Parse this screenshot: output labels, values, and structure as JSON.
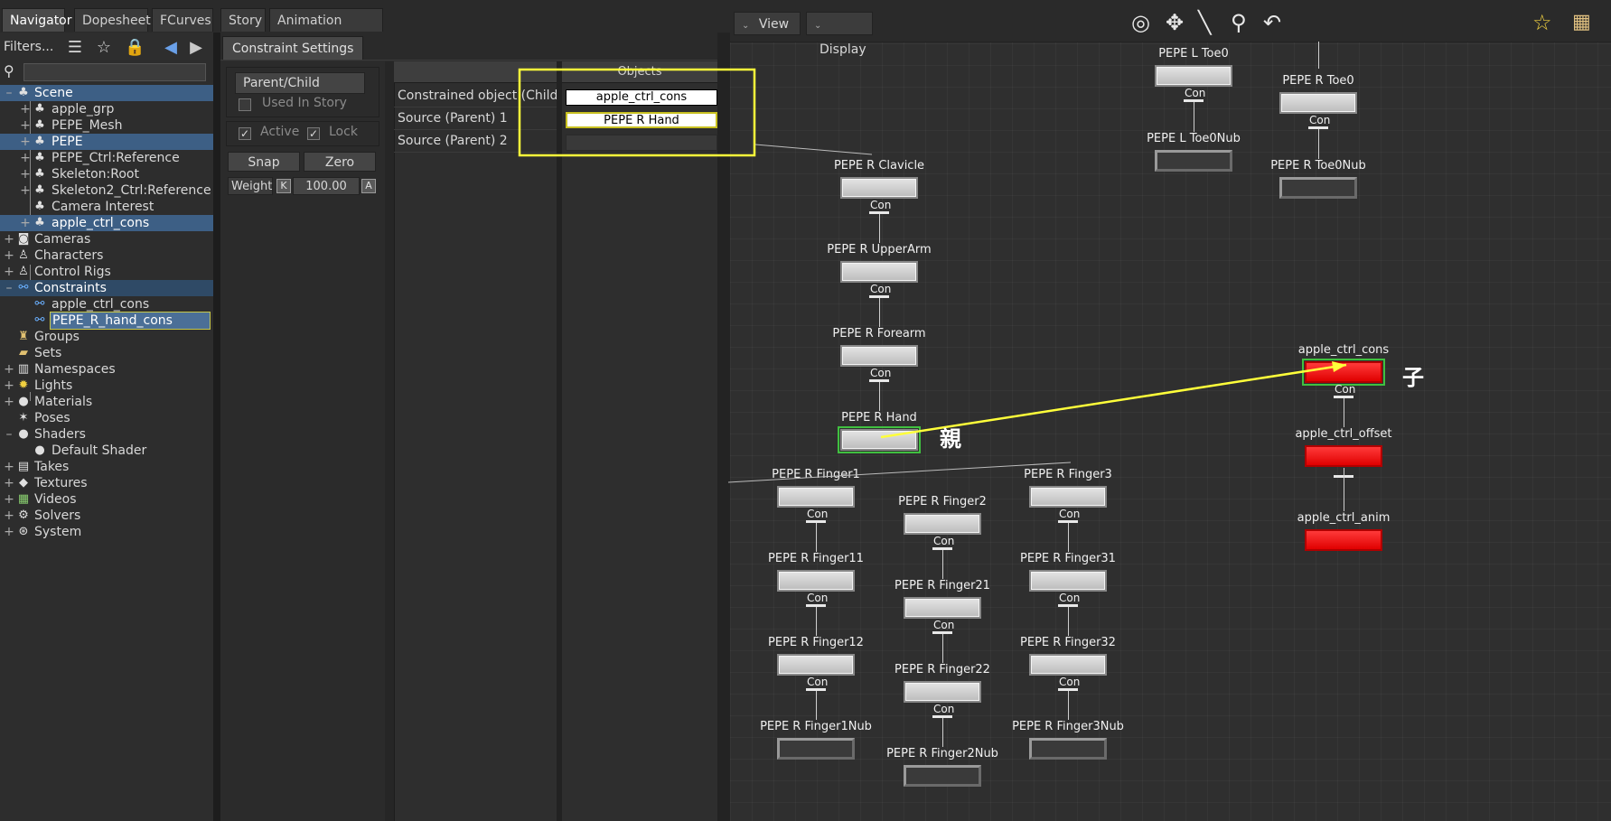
{
  "tabs": [
    "Navigator",
    "Dopesheet",
    "FCurves",
    "Story",
    "Animation Trigger"
  ],
  "navigator": {
    "filters_label": "Filters...",
    "search_value": "",
    "tree": [
      {
        "label": "Scene",
        "expander": "–",
        "icon": "scene-icon"
      },
      {
        "label": "apple_grp",
        "expander": "+",
        "icon": "model-icon"
      },
      {
        "label": "PEPE_Mesh",
        "expander": "+",
        "icon": "model-icon"
      },
      {
        "label": "PEPE",
        "expander": "+",
        "icon": "model-icon"
      },
      {
        "label": "PEPE_Ctrl:Reference",
        "expander": "+",
        "icon": "model-icon"
      },
      {
        "label": "Skeleton:Root",
        "expander": "+",
        "icon": "model-icon"
      },
      {
        "label": "Skeleton2_Ctrl:Reference",
        "expander": "+",
        "icon": "model-icon"
      },
      {
        "label": "Camera Interest",
        "expander": "",
        "icon": "model-icon"
      },
      {
        "label": "apple_ctrl_cons",
        "expander": "+",
        "icon": "model-icon"
      },
      {
        "label": "Cameras",
        "expander": "+",
        "icon": "camera-icon"
      },
      {
        "label": "Characters",
        "expander": "+",
        "icon": "character-icon"
      },
      {
        "label": "Control Rigs",
        "expander": "+",
        "icon": "control-rig-icon"
      },
      {
        "label": "Constraints",
        "expander": "–",
        "icon": "constraint-icon"
      },
      {
        "label": "apple_ctrl_cons",
        "expander": "",
        "icon": "constraint-icon"
      },
      {
        "label": "PEPE_R_hand_cons",
        "expander": "",
        "icon": "constraint-icon"
      },
      {
        "label": "Groups",
        "expander": "",
        "icon": "group-icon"
      },
      {
        "label": "Sets",
        "expander": "",
        "icon": "set-icon"
      },
      {
        "label": "Namespaces",
        "expander": "+",
        "icon": "namespace-icon"
      },
      {
        "label": "Lights",
        "expander": "+",
        "icon": "light-icon"
      },
      {
        "label": "Materials",
        "expander": "+",
        "icon": "material-icon"
      },
      {
        "label": "Poses",
        "expander": "",
        "icon": "pose-icon"
      },
      {
        "label": "Shaders",
        "expander": "–",
        "icon": "shader-icon"
      },
      {
        "label": "Default Shader",
        "expander": "",
        "icon": "shader-icon"
      },
      {
        "label": "Takes",
        "expander": "+",
        "icon": "take-icon"
      },
      {
        "label": "Textures",
        "expander": "+",
        "icon": "texture-icon"
      },
      {
        "label": "Videos",
        "expander": "+",
        "icon": "video-icon"
      },
      {
        "label": "Solvers",
        "expander": "+",
        "icon": "solver-icon"
      },
      {
        "label": "System",
        "expander": "+",
        "icon": "system-icon"
      }
    ]
  },
  "constraint_settings": {
    "tab": "Constraint Settings",
    "type": "Parent/Child",
    "used_in_story": "Used In Story",
    "active": "Active",
    "lock": "Lock",
    "snap": "Snap",
    "zero": "Zero",
    "weight_label": "Weight",
    "weight_key": "K",
    "weight_value": "100.00",
    "weight_anim": "A",
    "slots": [
      "Constrained object (Child)",
      "Source (Parent) 1",
      "Source (Parent) 2"
    ],
    "objects_header": "Objects",
    "objects": [
      "apple_ctrl_cons",
      "PEPE R Hand",
      ""
    ]
  },
  "schematic": {
    "view_label": "View",
    "display_label": "Display",
    "con_label": "Con",
    "nodes": [
      "PEPE L Toe0",
      "PEPE L Toe0Nub",
      "PEPE R Toe0",
      "PEPE R Toe0Nub",
      "PEPE R Clavicle",
      "PEPE R UpperArm",
      "PEPE R Forearm",
      "PEPE R Hand",
      "PEPE R Finger1",
      "PEPE R Finger11",
      "PEPE R Finger12",
      "PEPE R Finger1Nub",
      "PEPE R Finger2",
      "PEPE R Finger21",
      "PEPE R Finger22",
      "PEPE R Finger2Nub",
      "PEPE R Finger3",
      "PEPE R Finger31",
      "PEPE R Finger32",
      "PEPE R Finger3Nub",
      "apple_ctrl_cons",
      "apple_ctrl_offset",
      "apple_ctrl_anim"
    ],
    "annotation_parent": "親",
    "annotation_child": "子"
  },
  "colors": {
    "highlight_yellow": "#ffff3a",
    "selection_green": "#40c040",
    "constraint_red": "#ff1a1a",
    "selected_row": "#3d5f85"
  }
}
